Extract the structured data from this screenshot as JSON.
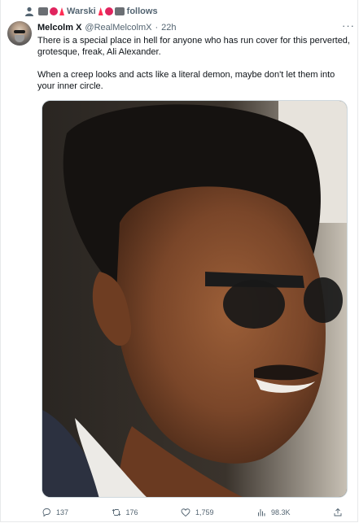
{
  "social_context": {
    "label": "Warski",
    "suffix": "follows"
  },
  "tweet": {
    "display_name": "Melcolm X",
    "handle": "@RealMelcolmX",
    "separator": "·",
    "time": "22h",
    "more": "···",
    "paragraphs": [
      "There is a special place in hell for anyone who has run cover for this perverted, grotesque, freak, Ali Alexander.",
      "When a creep looks and acts like a literal demon, maybe don't let them into your inner circle."
    ]
  },
  "actions": {
    "replies": "137",
    "reposts": "176",
    "likes": "1,759",
    "views": "98.3K"
  },
  "icons": {
    "context": "person-icon",
    "reply": "reply-icon",
    "repost": "repost-icon",
    "like": "heart-icon",
    "views": "analytics-icon",
    "share": "share-icon"
  },
  "colors": {
    "text": "#0f1419",
    "secondary": "#536471",
    "border": "#cfd9de"
  }
}
